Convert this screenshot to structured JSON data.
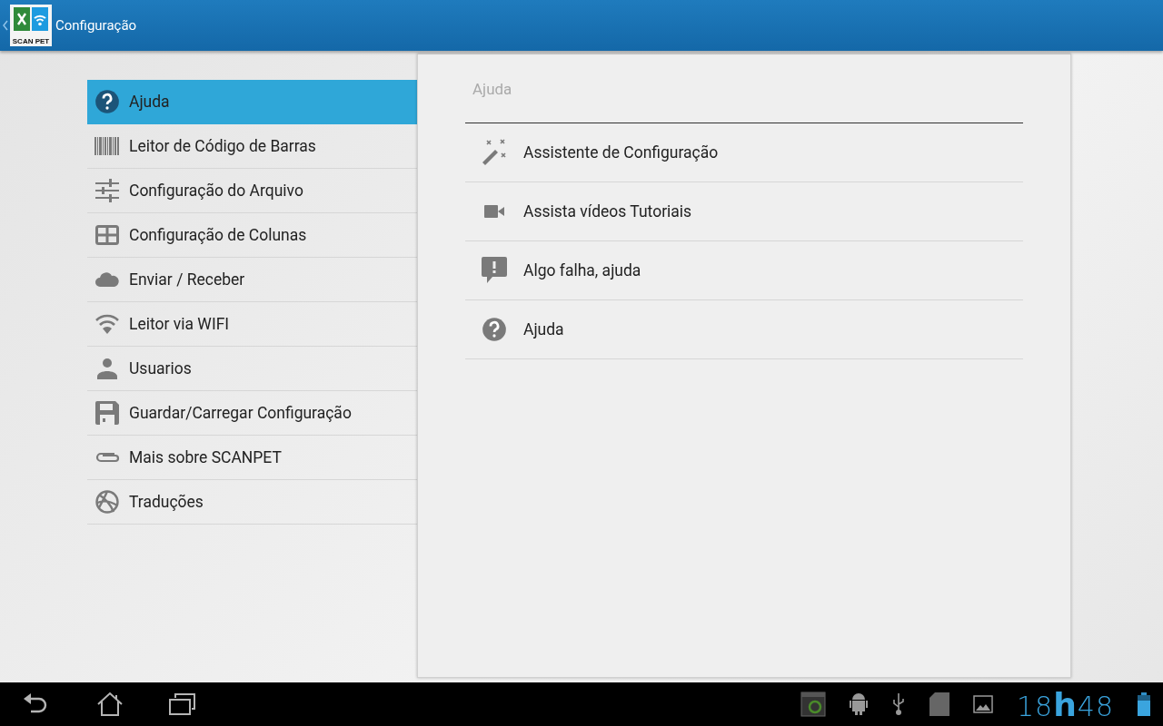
{
  "action_bar": {
    "logo_label": "SCAN PET",
    "title": "Configuração"
  },
  "menu": [
    {
      "label": "Ajuda",
      "kind": "help",
      "selected": true
    },
    {
      "label": "Leitor de Código de Barras",
      "kind": "barcode",
      "selected": false
    },
    {
      "label": "Configuração do Arquivo",
      "kind": "sliders",
      "selected": false
    },
    {
      "label": "Configuração de Colunas",
      "kind": "grid",
      "selected": false
    },
    {
      "label": "Enviar / Receber",
      "kind": "cloud",
      "selected": false
    },
    {
      "label": "Leitor via WIFI",
      "kind": "wifi",
      "selected": false
    },
    {
      "label": "Usuarios",
      "kind": "person",
      "selected": false
    },
    {
      "label": "Guardar/Carregar Configuração",
      "kind": "floppy",
      "selected": false
    },
    {
      "label": "Mais sobre SCANPET",
      "kind": "clip",
      "selected": false
    },
    {
      "label": "Traduções",
      "kind": "globe",
      "selected": false
    }
  ],
  "panel": {
    "header": "Ajuda",
    "items": [
      {
        "label": "Assistente de Configuração",
        "kind": "wand"
      },
      {
        "label": "Assista vídeos Tutoriais",
        "kind": "video"
      },
      {
        "label": "Algo falha, ajuda",
        "kind": "alert"
      },
      {
        "label": "Ajuda",
        "kind": "help"
      }
    ]
  },
  "status_bar": {
    "clock": {
      "hours": "18",
      "separator": "h",
      "minutes": "48"
    }
  }
}
